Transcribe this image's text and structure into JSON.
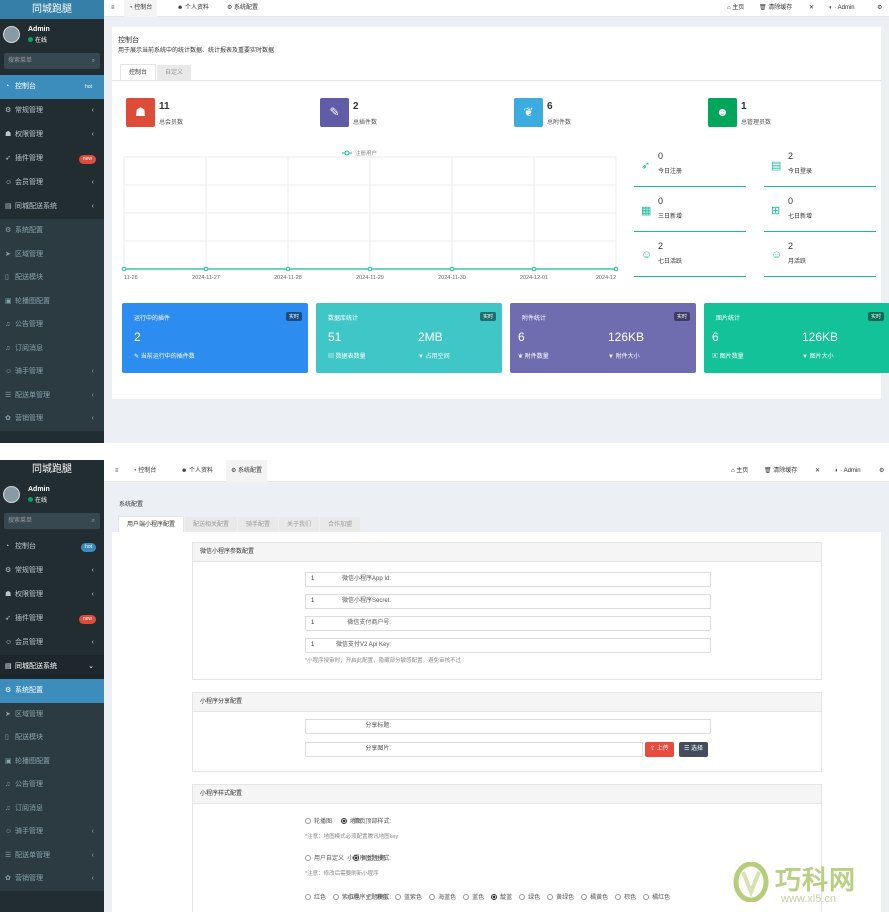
{
  "brand": {
    "logo_text": "同城跑腿"
  },
  "user": {
    "name": "Admin",
    "status": "在线"
  },
  "sidebar": {
    "search_placeholder": "搜索菜单",
    "items": [
      {
        "label": "控制台",
        "icon": "dashboard-icon",
        "badge": "hot",
        "badge_color": "#3c8dbc"
      },
      {
        "label": "常规管理",
        "icon": "cogs-icon",
        "chevron": "‹"
      },
      {
        "label": "权限管理",
        "icon": "group-icon",
        "chevron": "‹"
      },
      {
        "label": "插件管理",
        "icon": "rocket-icon",
        "badge": "new",
        "badge_color": "#dd4b39"
      },
      {
        "label": "会员管理",
        "icon": "user-circle-icon",
        "chevron": "‹"
      },
      {
        "label": "同城配送系统",
        "icon": "book-icon",
        "chevron": "‹"
      }
    ],
    "sub_items": [
      {
        "label": "系统配置",
        "icon": "cogs-icon"
      },
      {
        "label": "区域管理",
        "icon": "send-icon"
      },
      {
        "label": "配送模块",
        "icon": "file-icon"
      },
      {
        "label": "轮播图配置",
        "icon": "image-icon"
      },
      {
        "label": "公告管理",
        "icon": "bell-icon"
      },
      {
        "label": "订阅消息",
        "icon": "bell-icon"
      },
      {
        "label": "骑手管理",
        "icon": "user-circle-icon",
        "chevron": "‹"
      },
      {
        "label": "配送单管理",
        "icon": "list-icon",
        "chevron": "‹"
      },
      {
        "label": "营销管理",
        "icon": "gift-icon",
        "chevron": "‹"
      }
    ]
  },
  "topnav": {
    "menu_icon": "≡",
    "tabs": [
      {
        "label": "控制台",
        "icon": "dashboard-icon"
      },
      {
        "label": "个人资料",
        "icon": "user-icon"
      },
      {
        "label": "系统配置",
        "icon": "cogs-icon"
      }
    ],
    "home": "主页",
    "clear_cache": "清除缓存",
    "admin_label": "Admin"
  },
  "dashboard": {
    "title": "控制台",
    "desc": "用于展示当前系统中的统计数据、统计报表及重要实时数据",
    "tabs": [
      "控制台",
      "自定义"
    ],
    "stats": [
      {
        "value": "11",
        "label": "总会员数",
        "color": "#dd4b39",
        "icon": "users-icon"
      },
      {
        "value": "2",
        "label": "总插件数",
        "color": "#605ca8",
        "icon": "magic-icon"
      },
      {
        "value": "6",
        "label": "总附件数",
        "color": "#3c8dbc",
        "icon": "leaf-icon"
      },
      {
        "value": "1",
        "label": "总管理员数",
        "color": "#00a65a",
        "icon": "user-icon"
      }
    ],
    "chart_legend": "注册用户",
    "mini": [
      {
        "value": "0",
        "label": "今日注册",
        "icon": "rocket-icon"
      },
      {
        "value": "2",
        "label": "今日登录",
        "icon": "vcard-icon"
      },
      {
        "value": "0",
        "label": "三日新增",
        "icon": "calendar-icon"
      },
      {
        "value": "0",
        "label": "七日新增",
        "icon": "calendar-plus-icon"
      },
      {
        "value": "2",
        "label": "七日活跃",
        "icon": "user-circle-icon"
      },
      {
        "value": "2",
        "label": "月活跃",
        "icon": "user-circle-icon"
      }
    ],
    "panels": [
      {
        "title": "运行中的插件",
        "tag": "实时",
        "v1": "2",
        "l1": "当前运行中的插件数",
        "v2": "",
        "l2": "",
        "color": "#2d8cf0"
      },
      {
        "title": "数据库统计",
        "tag": "实时",
        "v1": "51",
        "l1": "数据表数量",
        "v2": "2MB",
        "l2": "占用空间",
        "color": "#3fc7c7"
      },
      {
        "title": "附件统计",
        "tag": "实时",
        "v1": "6",
        "l1": "附件数量",
        "v2": "126KB",
        "l2": "附件大小",
        "color": "#6f6db0"
      },
      {
        "title": "图片统计",
        "tag": "实时",
        "v1": "6",
        "l1": "图片数量",
        "v2": "126KB",
        "l2": "图片大小",
        "color": "#14c29a"
      }
    ]
  },
  "chart_data": {
    "type": "line",
    "categories": [
      "11-26",
      "2024-11-27",
      "2024-11-28",
      "2024-11-29",
      "2024-11-30",
      "2024-12-01",
      "2024-12"
    ],
    "series": [
      {
        "name": "注册用户",
        "values": [
          0,
          0,
          0,
          0,
          0,
          0,
          0
        ]
      }
    ],
    "title": "",
    "xlabel": "",
    "ylabel": "",
    "legend": "top-center",
    "grid": true
  },
  "config": {
    "title": "系统配置",
    "tabs": [
      "用户端小程序配置",
      "配送相关配置",
      "骑手配置",
      "关于我们",
      "合作加盟"
    ],
    "section1": {
      "title": "微信小程序参数配置",
      "rows": [
        {
          "label": "微信小程序App Id:",
          "value": "1"
        },
        {
          "label": "微信小程序Secret:",
          "value": "1"
        },
        {
          "label": "微信支付商户号:",
          "value": "1"
        },
        {
          "label": "微信支付V2 Api Key:",
          "value": "1"
        }
      ],
      "hint": "*小程序授审时，开启此配置，隐藏部分敏感配置，避免审核不过"
    },
    "section2": {
      "title": "小程序分享配置",
      "share_title_label": "分享标题:",
      "share_image_label": "分享图片:",
      "upload": "上传",
      "choose": "选择"
    },
    "section3": {
      "title": "小程序样式配置",
      "home_mode_label": "首页顶部样式:",
      "home_mode_opts": [
        "轮播图",
        "地图"
      ],
      "home_mode_selected": 1,
      "home_mode_hint": "*注意：地图模式必须配置腾讯地图key",
      "theme_mode_label": "小程序主题模式:",
      "theme_mode_opts": [
        "用户自定义",
        "固定主题"
      ],
      "theme_mode_selected": 1,
      "theme_mode_hint": "*注意：修改后需要刷新小程序",
      "theme_label": "小程序主题模式:",
      "theme_opts": [
        "红色",
        "紫红色",
        "紫色",
        "蓝紫色",
        "海蓝色",
        "蓝色",
        "靛蓝",
        "绿色",
        "黄绿色",
        "橘黄色",
        "棕色",
        "橘红色"
      ],
      "theme_selected": 6
    }
  },
  "watermark": {
    "text": "巧科网",
    "url": "www.xl5.cn"
  }
}
